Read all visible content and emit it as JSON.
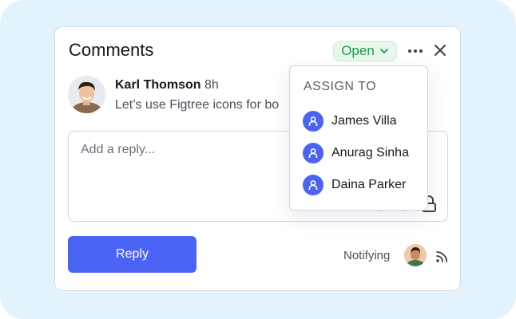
{
  "header": {
    "title": "Comments",
    "status_label": "Open"
  },
  "comment": {
    "author": "Karl Thomson",
    "time": "8h",
    "text": "Let’s use Figtree icons for bo"
  },
  "reply": {
    "placeholder": "Add a reply...",
    "button_label": "Reply"
  },
  "footer": {
    "notifying_label": "Notifying"
  },
  "assign_menu": {
    "header": "ASSIGN TO",
    "users": [
      {
        "name": "James Villa"
      },
      {
        "name": "Anurag Sinha"
      },
      {
        "name": "Daina Parker"
      }
    ]
  },
  "colors": {
    "accent": "#4b63f5",
    "status_green": "#1d9a4a",
    "background": "#e3f3fd"
  }
}
